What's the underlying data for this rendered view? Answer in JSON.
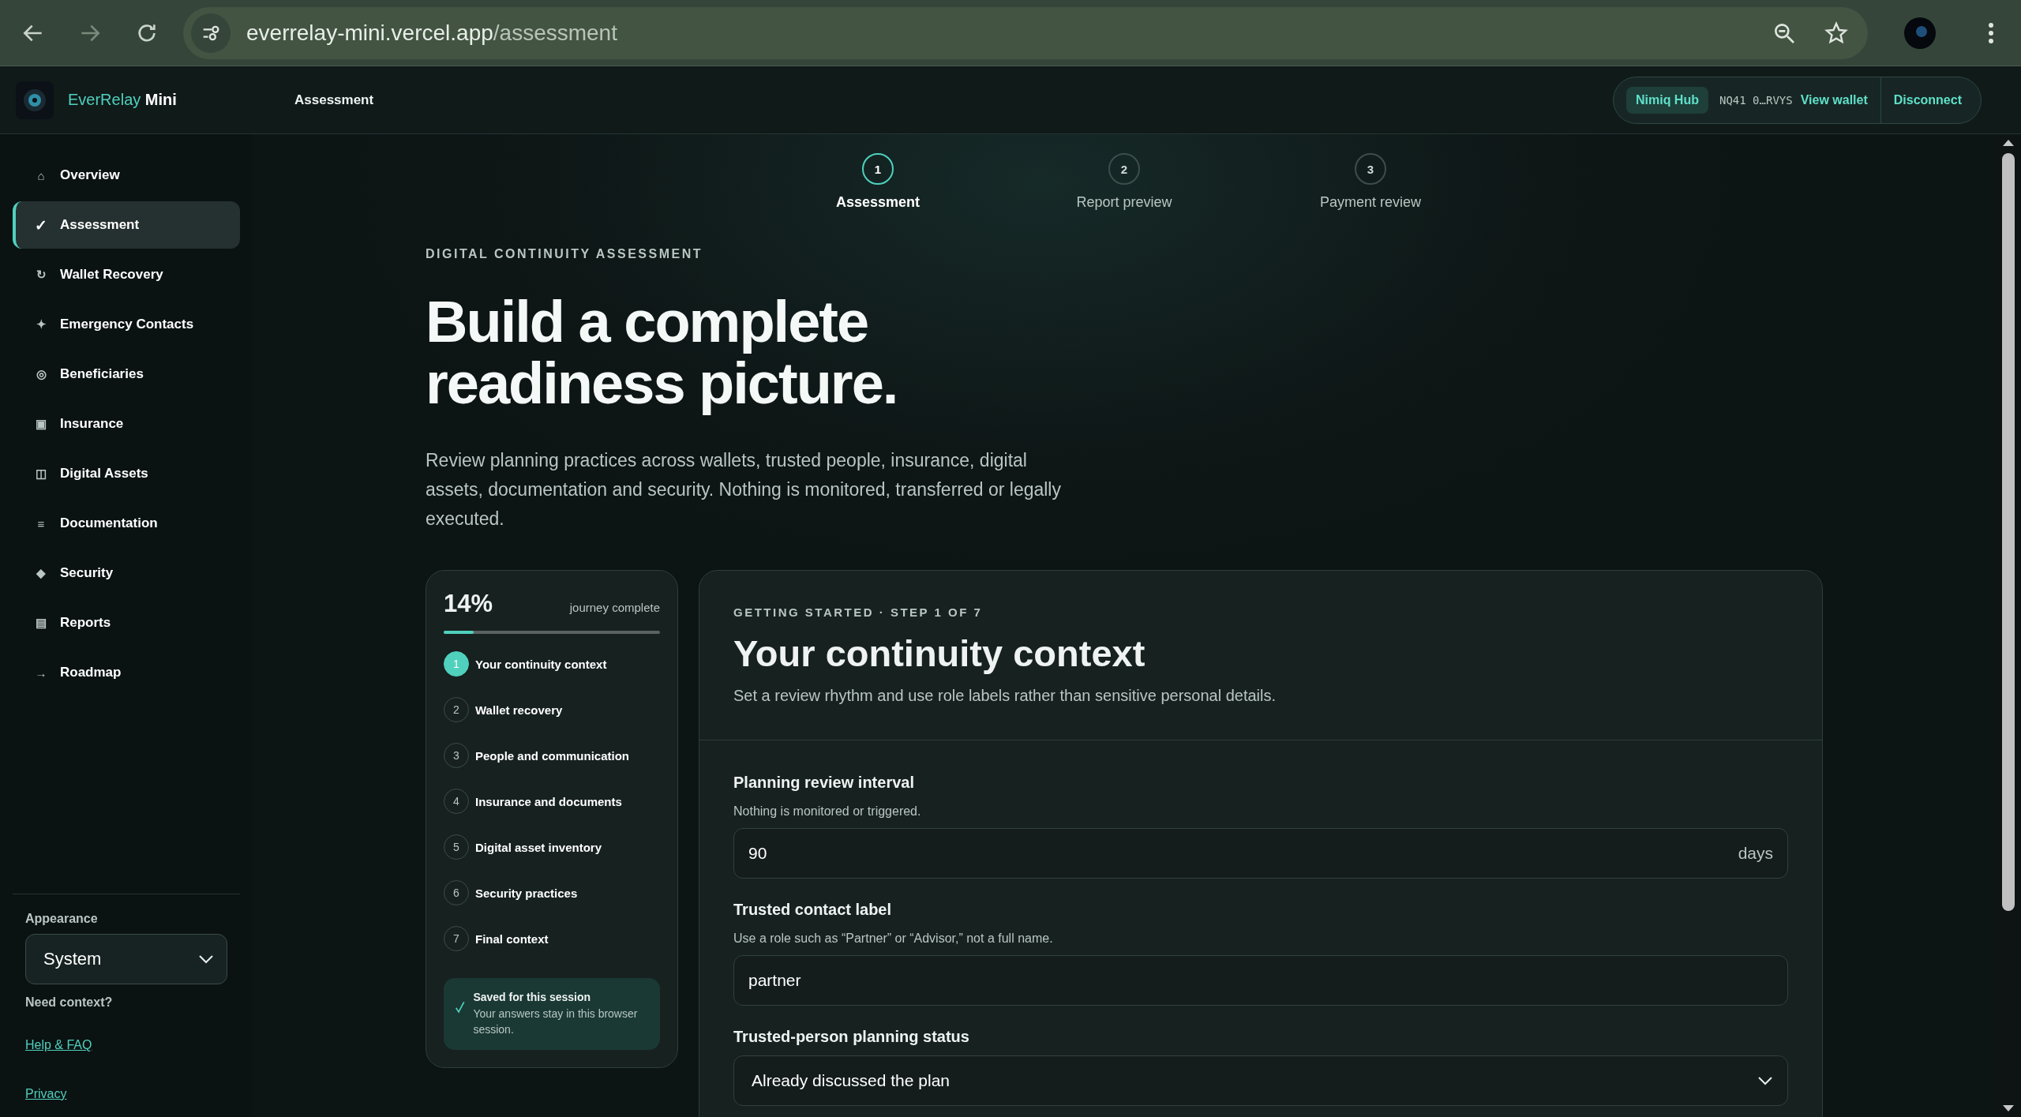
{
  "browser": {
    "url_host": "everrelay-mini.vercel.app",
    "url_path": "/assessment"
  },
  "header": {
    "brand": "EverRelay",
    "brand_suffix": "Mini",
    "page_title": "Assessment",
    "wallet": {
      "provider": "Nimiq Hub",
      "address": "NQ41 0…RVYS",
      "view_link": "View wallet",
      "disconnect": "Disconnect"
    }
  },
  "sidebar": {
    "items": [
      {
        "icon": "⌂",
        "label": "Overview",
        "selected": false
      },
      {
        "icon": "✓",
        "label": "Assessment",
        "selected": true
      },
      {
        "icon": "↻",
        "label": "Wallet Recovery",
        "selected": false
      },
      {
        "icon": "✦",
        "label": "Emergency Contacts",
        "selected": false
      },
      {
        "icon": "◎",
        "label": "Beneficiaries",
        "selected": false
      },
      {
        "icon": "▣",
        "label": "Insurance",
        "selected": false
      },
      {
        "icon": "◫",
        "label": "Digital Assets",
        "selected": false
      },
      {
        "icon": "≡",
        "label": "Documentation",
        "selected": false
      },
      {
        "icon": "◆",
        "label": "Security",
        "selected": false
      },
      {
        "icon": "▤",
        "label": "Reports",
        "selected": false
      },
      {
        "icon": "→",
        "label": "Roadmap",
        "selected": false
      }
    ],
    "appearance": {
      "label": "Appearance",
      "value": "System"
    },
    "help_heading": "Need context?",
    "links": [
      "Help & FAQ",
      "Privacy"
    ]
  },
  "stepper": [
    {
      "number": "1",
      "label": "Assessment",
      "selected": true
    },
    {
      "number": "2",
      "label": "Report preview",
      "selected": false
    },
    {
      "number": "3",
      "label": "Payment review",
      "selected": false
    }
  ],
  "hero": {
    "eyebrow": "DIGITAL CONTINUITY ASSESSMENT",
    "title_lines": [
      "Build a complete",
      "readiness picture."
    ],
    "text": "Review planning practices across wallets, trusted people, insurance, digital assets, documentation and security. Nothing is monitored, transferred or legally executed."
  },
  "progress": {
    "percent": "14%",
    "caption": "journey complete",
    "level": 0.14,
    "steps": [
      {
        "number": "1",
        "label": "Your continuity context",
        "selected": true
      },
      {
        "number": "2",
        "label": "Wallet recovery",
        "selected": false
      },
      {
        "number": "3",
        "label": "People and communication",
        "selected": false
      },
      {
        "number": "4",
        "label": "Insurance and documents",
        "selected": false
      },
      {
        "number": "5",
        "label": "Digital asset inventory",
        "selected": false
      },
      {
        "number": "6",
        "label": "Security practices",
        "selected": false
      },
      {
        "number": "7",
        "label": "Final context",
        "selected": false
      }
    ],
    "saved": {
      "title": "Saved for this session",
      "text": "Your answers stay in this browser session."
    }
  },
  "form": {
    "eyebrow": "GETTING STARTED · STEP 1 OF 7",
    "title": "Your continuity context",
    "subtitle": "Set a review rhythm and use role labels rather than sensitive personal details.",
    "fields": [
      {
        "kind": "number",
        "label": "Planning review interval",
        "hint": "Nothing is monitored or triggered.",
        "value": "90",
        "unit": "days"
      },
      {
        "kind": "text",
        "label": "Trusted contact label",
        "hint": "Use a role such as “Partner” or “Advisor,” not a full name.",
        "value": "partner"
      },
      {
        "kind": "select",
        "label": "Trusted-person planning status",
        "value": "Already discussed the plan"
      }
    ]
  }
}
